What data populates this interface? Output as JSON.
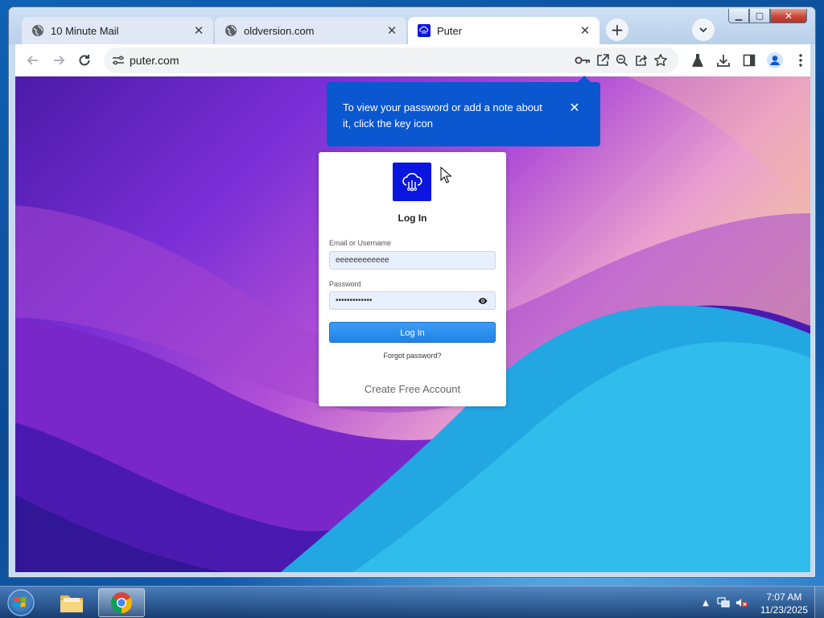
{
  "browser": {
    "tabs": [
      {
        "title": "10 Minute Mail",
        "icon": "globe-icon",
        "active": false
      },
      {
        "title": "oldversion.com",
        "icon": "globe-icon",
        "active": false
      },
      {
        "title": "Puter",
        "icon": "puter-favicon",
        "active": true
      }
    ],
    "address_bar": {
      "url": "puter.com"
    },
    "password_bubble": {
      "text": "To view your password or add a note about it, click the key icon"
    }
  },
  "login": {
    "title": "Log In",
    "email_label": "Email or Username",
    "email_value": "eeeeeeeeeeee",
    "password_label": "Password",
    "password_value": "•••••••••••••",
    "login_button": "Log In",
    "forgot_password": "Forgot password?",
    "create_account": "Create Free Account"
  },
  "taskbar": {
    "apps": [
      {
        "name": "windows-explorer",
        "icon": "folder-icon"
      },
      {
        "name": "chrome",
        "icon": "chrome-icon",
        "active": true
      }
    ],
    "clock": {
      "time": "7:07 AM",
      "date": "11/23/2025"
    }
  },
  "colors": {
    "bubble": "#0b57d0",
    "login_button": "#1f82e6",
    "logo": "#0a16e0"
  }
}
